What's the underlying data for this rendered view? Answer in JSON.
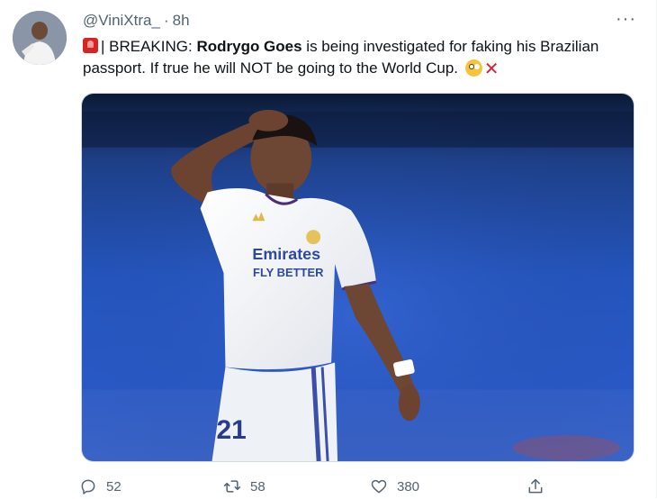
{
  "tweet": {
    "handle": "@ViniXtra_",
    "separator": "·",
    "time": "8h",
    "more_label": "···",
    "text": {
      "part1": "| BREAKING: ",
      "bold": "Rodrygo Goes",
      "part2": " is being investigated for faking his Brazilian passport. If true he will NOT be going to the World Cup.",
      "emoji_icons": [
        "siren-icon",
        "flushed-face-icon",
        "cross-mark-icon"
      ]
    },
    "media": {
      "jersey_text_line1": "Emirates",
      "jersey_text_line2": "FLY BETTER",
      "shorts_number": "21"
    },
    "actions": {
      "replies": "52",
      "retweets": "58",
      "likes": "380"
    }
  },
  "colors": {
    "text_primary": "#0f1419",
    "text_secondary": "#536471",
    "stadium_blue": "#1b4fb3"
  }
}
